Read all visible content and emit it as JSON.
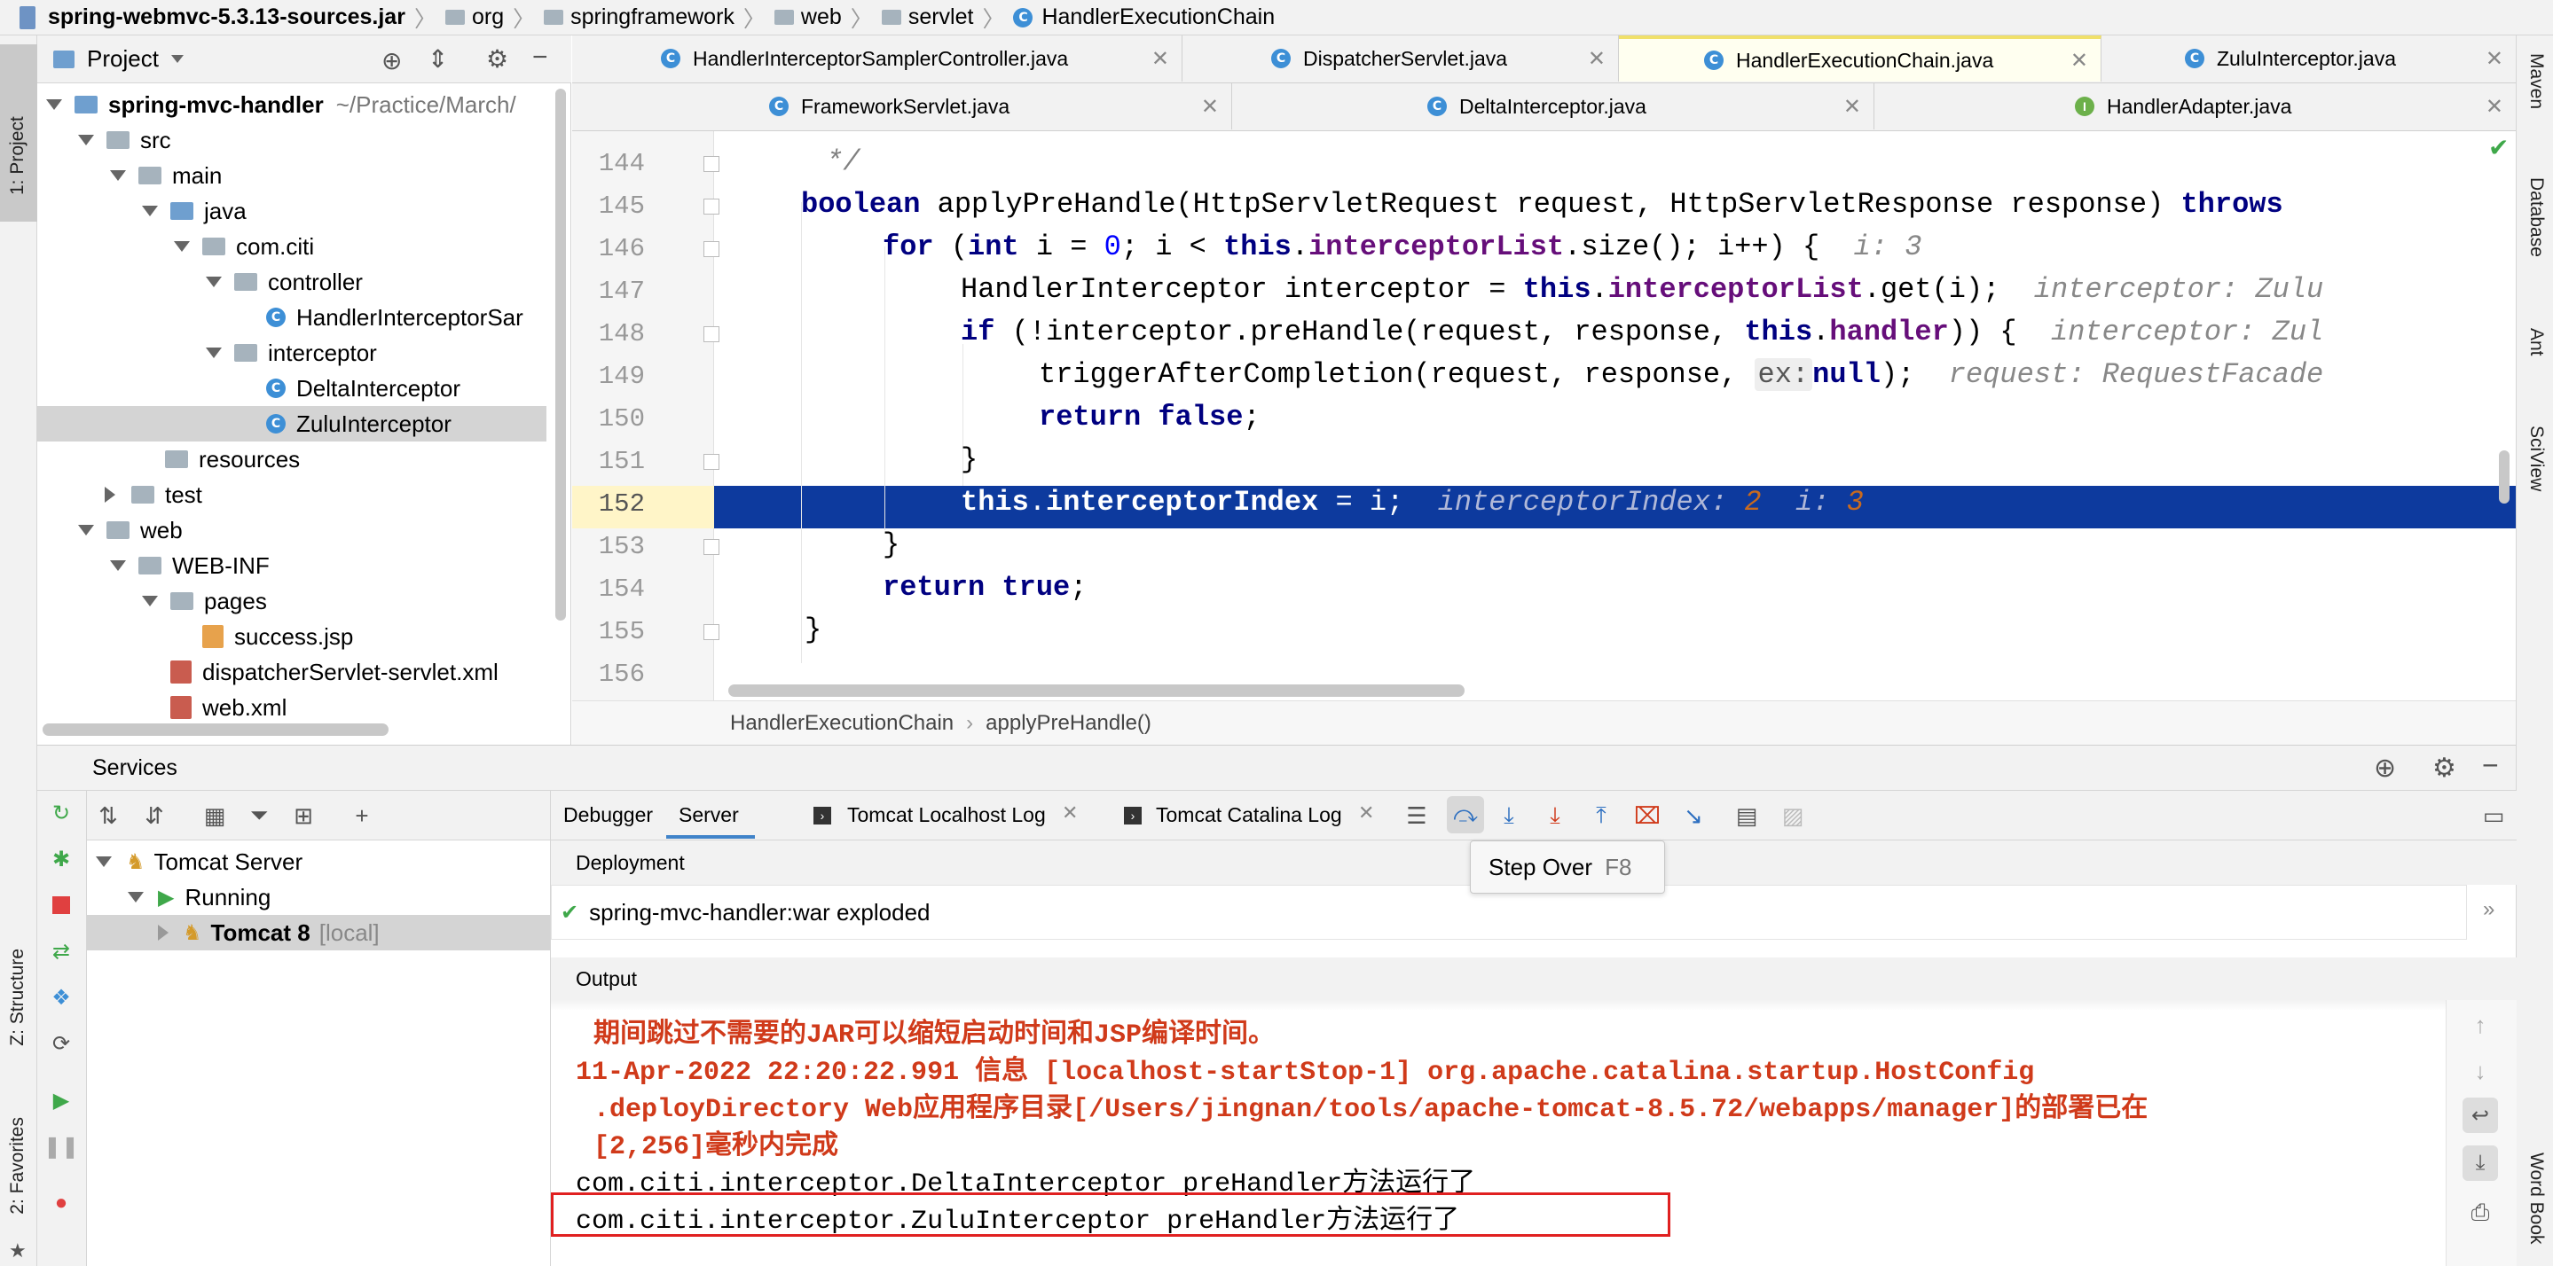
{
  "breadcrumb": {
    "items": [
      "spring-webmvc-5.3.13-sources.jar",
      "org",
      "springframework",
      "web",
      "servlet",
      "HandlerExecutionChain"
    ]
  },
  "left_strip": {
    "project_label": "1: Project",
    "structure_label": "Z: Structure",
    "favorites_label": "2: Favorites"
  },
  "right_strip": {
    "items": [
      "Maven",
      "Database",
      "Ant",
      "SciView",
      "Word Book"
    ]
  },
  "project_panel": {
    "title": "Project",
    "tree": [
      {
        "label": "spring-mvc-handler",
        "suffix": "~/Practice/March/",
        "kind": "module"
      },
      {
        "label": "src",
        "kind": "folder"
      },
      {
        "label": "main",
        "kind": "folder"
      },
      {
        "label": "java",
        "kind": "folder"
      },
      {
        "label": "com.citi",
        "kind": "package"
      },
      {
        "label": "controller",
        "kind": "package"
      },
      {
        "label": "HandlerInterceptorSar",
        "kind": "class"
      },
      {
        "label": "interceptor",
        "kind": "package"
      },
      {
        "label": "DeltaInterceptor",
        "kind": "class"
      },
      {
        "label": "ZuluInterceptor",
        "kind": "class"
      },
      {
        "label": "resources",
        "kind": "folder"
      },
      {
        "label": "test",
        "kind": "folder"
      },
      {
        "label": "web",
        "kind": "folder"
      },
      {
        "label": "WEB-INF",
        "kind": "folder"
      },
      {
        "label": "pages",
        "kind": "folder"
      },
      {
        "label": "success.jsp",
        "kind": "jsp"
      },
      {
        "label": "dispatcherServlet-servlet.xml",
        "kind": "xml"
      },
      {
        "label": "web.xml",
        "kind": "xml"
      }
    ]
  },
  "editor_tabs": {
    "row1": [
      {
        "label": "HandlerInterceptorSamplerController.java",
        "icon": "C",
        "active": false
      },
      {
        "label": "DispatcherServlet.java",
        "icon": "C",
        "active": false
      },
      {
        "label": "HandlerExecutionChain.java",
        "icon": "C",
        "active": true
      },
      {
        "label": "ZuluInterceptor.java",
        "icon": "C",
        "active": false
      }
    ],
    "row2": [
      {
        "label": "FrameworkServlet.java",
        "icon": "C",
        "active": false
      },
      {
        "label": "DeltaInterceptor.java",
        "icon": "C",
        "active": false
      },
      {
        "label": "HandlerAdapter.java",
        "icon": "I",
        "active": false
      }
    ]
  },
  "editor": {
    "line_numbers": [
      "144",
      "145",
      "146",
      "147",
      "148",
      "149",
      "150",
      "151",
      "152",
      "153",
      "154",
      "155",
      "156"
    ],
    "current_line": "152",
    "lines": {
      "l144": "*/",
      "l145_kw": "boolean",
      "l145_rest": " applyPreHandle(HttpServletRequest request, HttpServletResponse response) ",
      "l145_throws": "throws",
      "l146_for": "for",
      "l146_a": " (",
      "l146_int": "int",
      "l146_b": " i = ",
      "l146_zero": "0",
      "l146_c": "; i < ",
      "l146_this": "this",
      "l146_d": ".",
      "l146_fld": "interceptorList",
      "l146_e": ".size(); i++) {",
      "l146_hint": "i: 3",
      "l147_a": "HandlerInterceptor interceptor = ",
      "l147_this": "this",
      "l147_b": ".",
      "l147_fld": "interceptorList",
      "l147_c": ".get(i);",
      "l147_hint": "interceptor: Zulu",
      "l148_if": "if",
      "l148_a": " (!interceptor.preHandle(request, response, ",
      "l148_this": "this",
      "l148_b": ".",
      "l148_fld": "handler",
      "l148_c": ")) {",
      "l148_hint": "interceptor: Zul",
      "l149_a": "triggerAfterCompletion(request, response, ",
      "l149_ex": "ex:",
      "l149_null": "null",
      "l149_b": ");",
      "l149_hint": "request: RequestFacade",
      "l150_ret": "return",
      "l150_false": "false",
      "l150_b": ";",
      "l151": "}",
      "l152_this": "this",
      "l152_b": ".",
      "l152_fld": "interceptorIndex",
      "l152_c": " = i;",
      "l152_hint1": "interceptorIndex:",
      "l152_val1": "2",
      "l152_hint2": "i:",
      "l152_val2": "3",
      "l153": "}",
      "l154_ret": "return",
      "l154_true": "true",
      "l154_b": ";",
      "l155": "}"
    },
    "breadcrumb": [
      "HandlerExecutionChain",
      "applyPreHandle()"
    ]
  },
  "services": {
    "title": "Services",
    "tree": [
      {
        "label": "Tomcat Server"
      },
      {
        "label": "Running"
      },
      {
        "label": "Tomcat 8",
        "suffix": "[local]"
      }
    ],
    "tabs": [
      {
        "label": "Debugger",
        "active": false
      },
      {
        "label": "Server",
        "active": true
      },
      {
        "label": "Tomcat Localhost Log",
        "active": false
      },
      {
        "label": "Tomcat Catalina Log",
        "active": false
      }
    ],
    "tooltip": {
      "label": "Step Over",
      "shortcut": "F8"
    },
    "deployment_label": "Deployment",
    "deployment_item": "spring-mvc-handler:war exploded",
    "output_label": "Output",
    "output_lines": [
      "期间跳过不需要的JAR可以缩短启动时间和JSP编译时间。",
      "11-Apr-2022 22:20:22.991 信息 [localhost-startStop-1] org.apache.catalina.startup.HostConfig",
      ".deployDirectory Web应用程序目录[/Users/jingnan/tools/apache-tomcat-8.5.72/webapps/manager]的部署已在",
      "[2,256]毫秒内完成",
      "com.citi.interceptor.DeltaInterceptor preHandler方法运行了",
      "com.citi.interceptor.ZuluInterceptor preHandler方法运行了"
    ]
  },
  "colors": {
    "selection": "#0d3a9e",
    "keyword": "#000080",
    "field": "#660e7a",
    "number": "#0000ff",
    "log_red": "#d03a1a",
    "highlight_box": "#e02020"
  }
}
